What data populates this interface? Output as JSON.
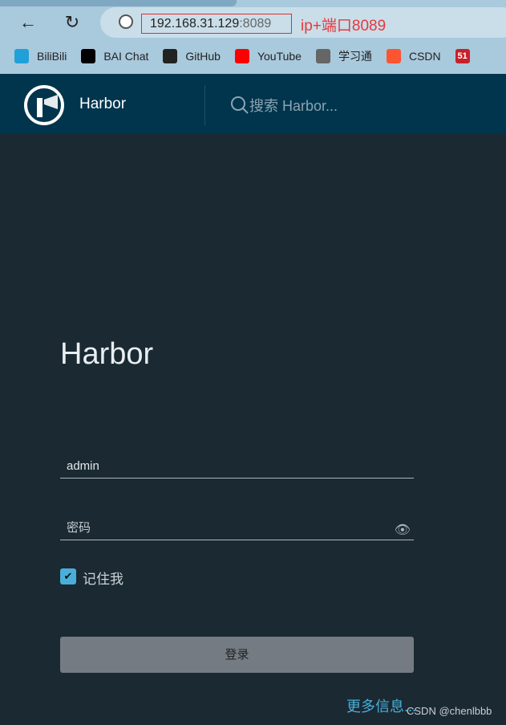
{
  "browser": {
    "url_host": "192.168.31.129",
    "url_port": ":8089",
    "annotation": "ip+端口8089",
    "bookmarks": [
      {
        "label": "BiliBili",
        "icon": "bilibili-icon",
        "color": "#20a0d8"
      },
      {
        "label": "BAI Chat",
        "icon": "bai-chat-icon",
        "color": "#000000"
      },
      {
        "label": "GitHub",
        "icon": "github-icon",
        "color": "#222222"
      },
      {
        "label": "YouTube",
        "icon": "youtube-icon",
        "color": "#ff0000"
      },
      {
        "label": "学习通",
        "icon": "globe-icon",
        "color": "#666666"
      },
      {
        "label": "CSDN",
        "icon": "csdn-icon",
        "color": "#fc5531"
      },
      {
        "label": "",
        "icon": "51cto-icon",
        "color": "#c8202a"
      }
    ]
  },
  "header": {
    "brand": "Harbor",
    "search_placeholder": "搜索 Harbor..."
  },
  "login": {
    "title": "Harbor",
    "username": "admin",
    "password_placeholder": "密码",
    "remember_label": "记住我",
    "remember_checked": true,
    "submit_label": "登录",
    "more_info": "更多信息..."
  },
  "watermark": "CSDN @chenlbbb"
}
